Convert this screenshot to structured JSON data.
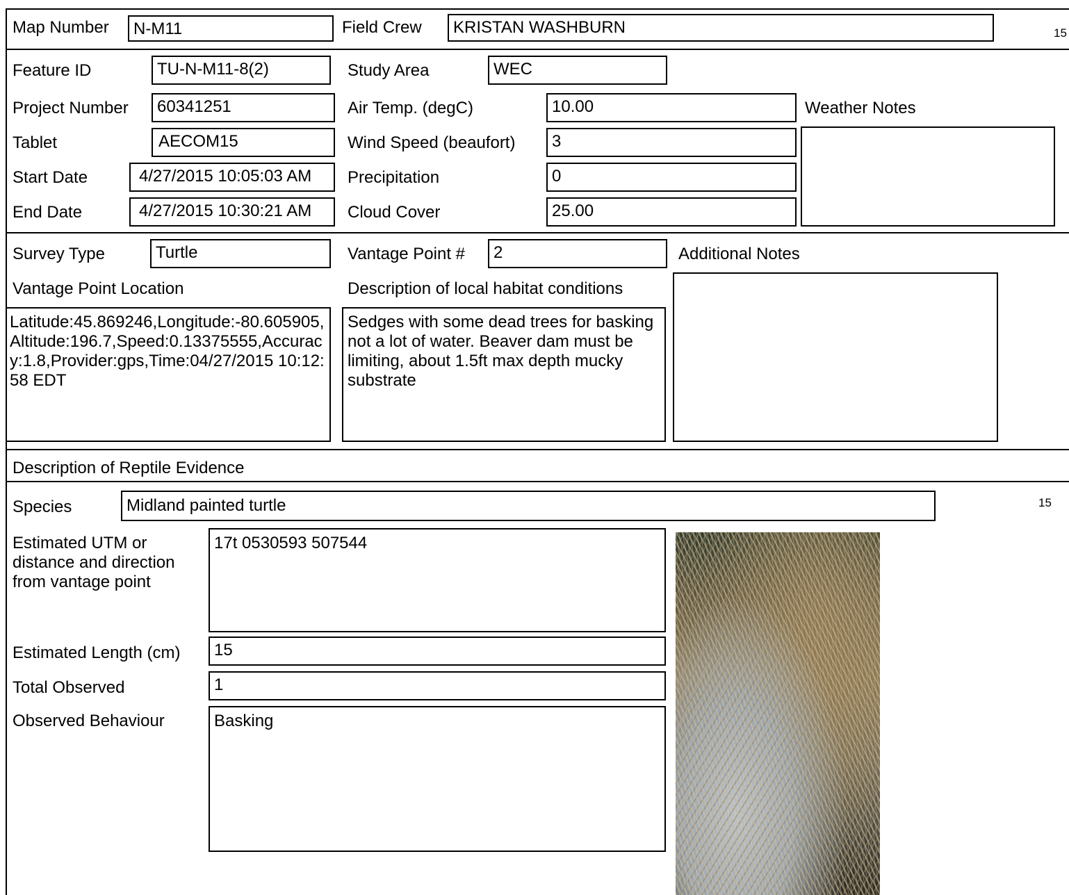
{
  "header": {
    "map_number_label": "Map Number",
    "map_number": "N-M11",
    "field_crew_label": "Field Crew",
    "field_crew": "KRISTAN  WASHBURN",
    "page_marker": "15"
  },
  "feature": {
    "feature_id_label": "Feature ID",
    "feature_id": "TU-N-M11-8(2)",
    "project_number_label": "Project Number",
    "project_number": "60341251",
    "tablet_label": "Tablet",
    "tablet": "AECOM15",
    "start_date_label": "Start Date",
    "start_date": "4/27/2015 10:05:03 AM",
    "end_date_label": "End Date",
    "end_date": "4/27/2015 10:30:21 AM"
  },
  "conditions": {
    "study_area_label": "Study Area",
    "study_area": "WEC",
    "air_temp_label": "Air Temp. (degC)",
    "air_temp": "10.00",
    "wind_speed_label": "Wind Speed (beaufort)",
    "wind_speed": "3",
    "precipitation_label": "Precipitation",
    "precipitation": "0",
    "cloud_cover_label": "Cloud Cover",
    "cloud_cover": "25.00",
    "weather_notes_label": "Weather Notes",
    "weather_notes": ""
  },
  "survey": {
    "survey_type_label": "Survey Type",
    "survey_type": "Turtle",
    "vantage_point_label": "Vantage Point #",
    "vantage_point": "2",
    "additional_notes_label": "Additional Notes",
    "additional_notes": "",
    "vantage_location_label": "Vantage Point Location",
    "vantage_location": "Latitude:45.869246,Longitude:-80.605905,Altitude:196.7,Speed:0.13375555,Accuracy:1.8,Provider:gps,Time:04/27/2015 10:12:58 EDT",
    "habitat_label": "Description of local habitat conditions",
    "habitat": "Sedges with some dead trees for basking not a lot of water. Beaver dam must be limiting, about 1.5ft max depth mucky substrate"
  },
  "evidence": {
    "section_label": "Description of Reptile Evidence",
    "species_label": "Species",
    "species": "Midland painted  turtle",
    "record_marker": "15",
    "utm_label_lines": [
      "Estimated UTM or",
      "distance and direction",
      "from vantage point"
    ],
    "utm": "17t 0530593 507544",
    "length_label": "Estimated Length (cm)",
    "length": "15",
    "total_label": "Total Observed",
    "total": "1",
    "behaviour_label": "Observed Behaviour",
    "behaviour": "Basking"
  }
}
